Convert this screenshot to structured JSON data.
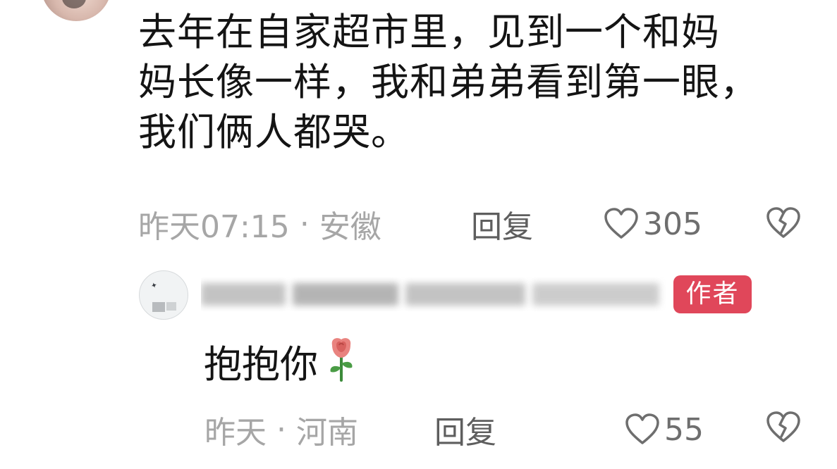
{
  "comment": {
    "lines": [
      "去年在自家超市里，见到一个和妈",
      "妈长像一样，我和弟弟看到第一眼，",
      "我们俩人都哭。"
    ],
    "time": "昨天07:15",
    "separator": "·",
    "location": "安徽",
    "reply_label": "回复",
    "like_count": "305"
  },
  "reply": {
    "badge": "作者",
    "text": "抱抱你",
    "time": "昨天",
    "separator": "·",
    "location": "河南",
    "reply_label": "回复",
    "like_count": "55"
  },
  "icons": {
    "like": "heart-outline-icon",
    "dislike": "broken-heart-icon",
    "rose": "rose-emoji-icon"
  },
  "colors": {
    "text": "#141414",
    "meta": "#a6a6a6",
    "badge": "#e0475a"
  }
}
